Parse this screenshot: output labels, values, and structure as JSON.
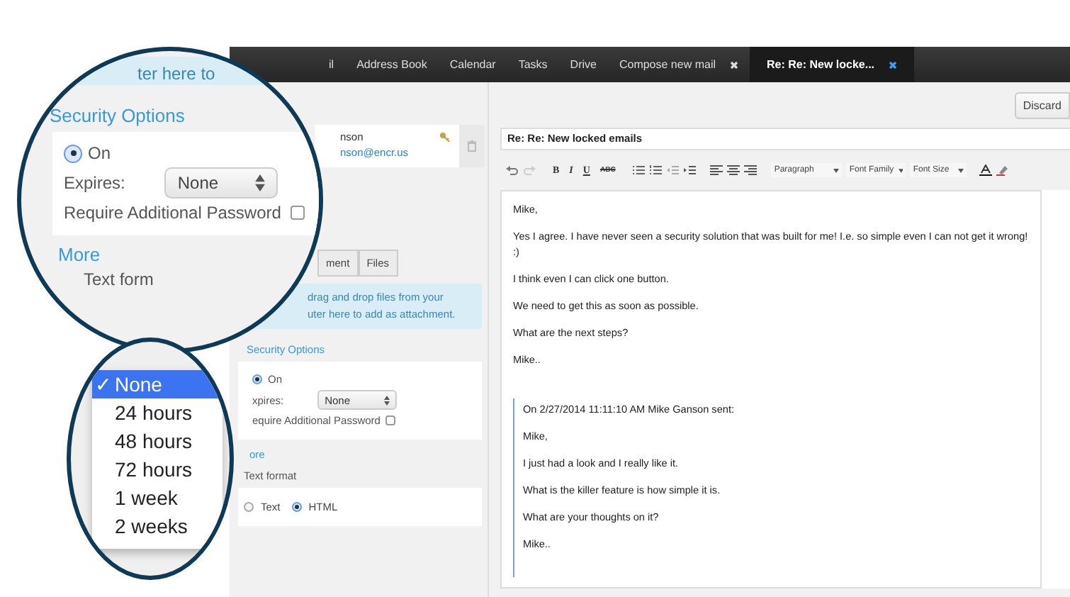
{
  "nav": {
    "tabs": [
      {
        "label": "il",
        "selected": false,
        "closable": false
      },
      {
        "label": "Address Book",
        "selected": false,
        "closable": false
      },
      {
        "label": "Calendar",
        "selected": false,
        "closable": false
      },
      {
        "label": "Tasks",
        "selected": false,
        "closable": false
      },
      {
        "label": "Drive",
        "selected": false,
        "closable": false
      },
      {
        "label": "Compose new mail",
        "selected": false,
        "closable": true
      },
      {
        "label": "Re: Re: New locke...",
        "selected": true,
        "closable": true
      }
    ]
  },
  "sidebar": {
    "recipient": {
      "name": "nson",
      "email": "nson@encr.us"
    },
    "attach_tabs": [
      {
        "label": "ment",
        "selected": false
      },
      {
        "label": "Files",
        "selected": false
      }
    ],
    "drop_zone": [
      "drag and drop files from your",
      "uter here to add as attachment."
    ],
    "security": {
      "title": "Security Options",
      "on": {
        "label": "On",
        "selected": true
      },
      "expires_label": "xpires:",
      "expires_value": "None",
      "password": {
        "label": "equire Additional Password",
        "checked": false
      }
    },
    "more": "ore",
    "text_format": {
      "label": "Text format",
      "options": [
        {
          "label": "Text",
          "selected": false
        },
        {
          "label": "HTML",
          "selected": true
        }
      ]
    }
  },
  "discard_button": "Discard",
  "subject": "Re:  Re: New locked emails",
  "toolbar": {
    "format_buttons": [
      "B",
      "I",
      "U",
      "ABC"
    ],
    "dropdowns": [
      "Paragraph",
      "Font Family",
      "Font Size"
    ]
  },
  "body": {
    "paragraphs": [
      "Mike,",
      "Yes I agree. I have never seen a security solution that was built for me! I.e. so simple even I can not get it wrong! :)",
      "I think even I can click one button.",
      "We need to get this as soon as possible.",
      "What are the next steps?",
      "Mike.."
    ],
    "quote": [
      "On 2/27/2014 11:11:10 AM Mike Ganson sent:",
      "Mike,",
      "I just had a look and I really like it.",
      "What is the killer feature is how simple it is.",
      "What are your thoughts on it?",
      "Mike.."
    ]
  },
  "magnifier_security": {
    "drop_text": "ter here to",
    "title": "Security Options",
    "on": {
      "label": "On",
      "selected": true
    },
    "expires_label": "Expires:",
    "expires_value": "None",
    "password": {
      "label": "Require Additional Password",
      "checked": false
    },
    "more": "More",
    "text_format": "Text form"
  },
  "magnifier_expiry_menu": {
    "mark": "✓",
    "options": [
      {
        "label": "None",
        "selected": true
      },
      {
        "label": "24 hours",
        "selected": false
      },
      {
        "label": "48 hours",
        "selected": false
      },
      {
        "label": "72 hours",
        "selected": false
      },
      {
        "label": "1 week",
        "selected": false
      },
      {
        "label": "2 weeks",
        "selected": false
      }
    ]
  }
}
